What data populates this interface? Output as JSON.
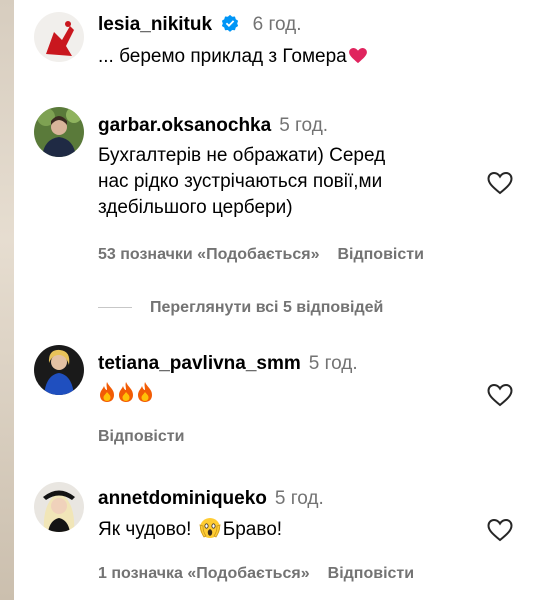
{
  "comments": [
    {
      "username": "lesia_nikituk",
      "time": "6 год.",
      "text": "... беремо приклад з Гомера"
    },
    {
      "username": "garbar.oksanochka",
      "time": "5 год.",
      "lines": [
        "Бухгалтерів не ображати) Серед",
        "нас рідко зустрічаються повії,ми",
        "здебільшого цербери)"
      ],
      "likes": "53 позначки «Подобається»",
      "reply": "Відповісти"
    },
    {
      "username": "tetiana_pavlivna_smm",
      "time": "5 год.",
      "reply": "Відповісти"
    },
    {
      "username": "annetdominiqueko",
      "time": "5 год.",
      "text_before": "Як чудово!",
      "text_after": "Браво!",
      "likes": "1 позначка «Подобається»",
      "reply": "Відповісти"
    }
  ],
  "view_replies": "Переглянути всі 5 відповідей",
  "icons": {
    "verified": "verified-badge-icon",
    "heart_outline": "heart-outline-icon",
    "heart_emoji": "red-heart-emoji",
    "fire_emoji": "fire-emoji",
    "scream_emoji": "face-screaming-emoji"
  },
  "colors": {
    "secondary_text": "#737373",
    "verified_blue": "#0095f6",
    "heart_red": "#e0245e"
  }
}
